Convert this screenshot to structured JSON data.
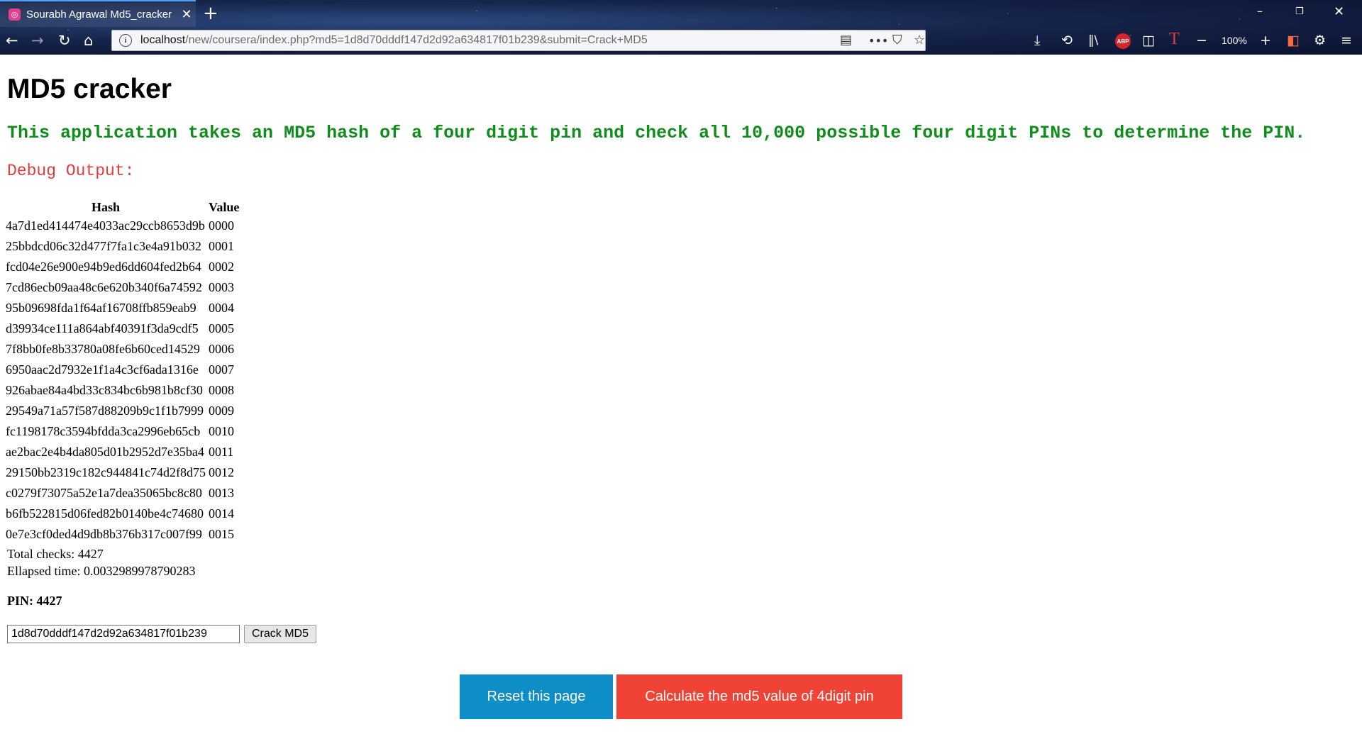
{
  "browser": {
    "tab_title": "Sourabh Agrawal Md5_cracker",
    "url_prefix": "localhost",
    "url_rest": "/new/coursera/index.php?md5=1d8d70dddf147d2d92a634817f01b239&submit=Crack+MD5",
    "zoom": "100%",
    "abp_label": "ABP"
  },
  "page": {
    "title": "MD5 cracker",
    "description": "This application takes an MD5 hash of a four digit pin and check all 10,000 possible four digit PINs to determine the PIN.",
    "debug_label": "Debug Output:",
    "table": {
      "headers": [
        "Hash",
        "Value"
      ],
      "rows": [
        [
          "4a7d1ed414474e4033ac29ccb8653d9b",
          "0000"
        ],
        [
          "25bbdcd06c32d477f7fa1c3e4a91b032",
          "0001"
        ],
        [
          "fcd04e26e900e94b9ed6dd604fed2b64",
          "0002"
        ],
        [
          "7cd86ecb09aa48c6e620b340f6a74592",
          "0003"
        ],
        [
          "95b09698fda1f64af16708ffb859eab9",
          "0004"
        ],
        [
          "d39934ce111a864abf40391f3da9cdf5",
          "0005"
        ],
        [
          "7f8bb0fe8b33780a08fe6b60ced14529",
          "0006"
        ],
        [
          "6950aac2d7932e1f1a4c3cf6ada1316e",
          "0007"
        ],
        [
          "926abae84a4bd33c834bc6b981b8cf30",
          "0008"
        ],
        [
          "29549a71a57f587d88209b9c1f1b7999",
          "0009"
        ],
        [
          "fc1198178c3594bfdda3ca2996eb65cb",
          "0010"
        ],
        [
          "ae2bac2e4b4da805d01b2952d7e35ba4",
          "0011"
        ],
        [
          "29150bb2319c182c944841c74d2f8d75",
          "0012"
        ],
        [
          "c0279f73075a52e1a7dea35065bc8c80",
          "0013"
        ],
        [
          "b6fb522815d06fed82b0140be4c74680",
          "0014"
        ],
        [
          "0e7e3cf0ded4d9db8b376b317c007f99",
          "0015"
        ]
      ]
    },
    "total_checks": "Total checks: 4427",
    "elapsed_time": "Ellapsed time: 0.0032989978790283",
    "pin_result": "PIN: 4427",
    "form": {
      "md5_value": "1d8d70dddf147d2d92a634817f01b239",
      "submit_label": "Crack MD5"
    },
    "reset_label": "Reset this page",
    "calc_label": "Calculate the md5 value of 4digit pin"
  }
}
